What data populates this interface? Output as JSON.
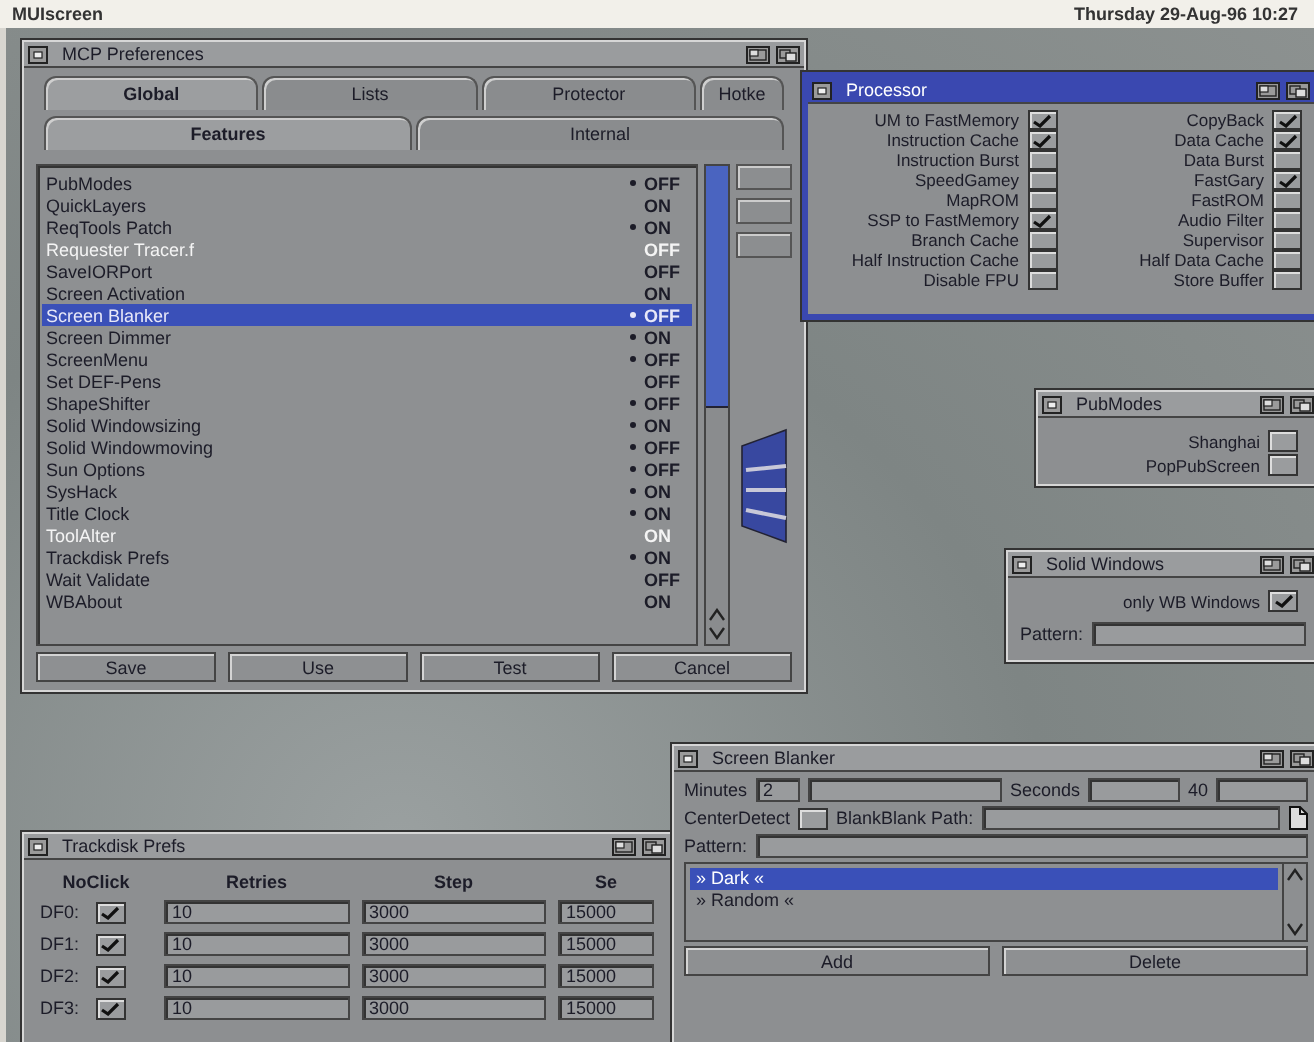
{
  "screen_title": "MUIscreen",
  "clock": "Thursday 29-Aug-96 10:27",
  "mcp_window": {
    "title": "MCP Preferences",
    "tabs": [
      {
        "label": "Global",
        "selected": true
      },
      {
        "label": "Lists",
        "selected": false
      },
      {
        "label": "Protector",
        "selected": false
      },
      {
        "label": "Hotke",
        "selected": false
      }
    ],
    "subtabs": [
      {
        "label": "Features",
        "selected": true
      },
      {
        "label": "Internal",
        "selected": false
      }
    ],
    "items": [
      {
        "name": "PubModes",
        "marked": true,
        "value": "OFF",
        "disabled": false,
        "selected": false
      },
      {
        "name": "QuickLayers",
        "marked": false,
        "value": "ON",
        "disabled": false,
        "selected": false
      },
      {
        "name": "ReqTools Patch",
        "marked": true,
        "value": "ON",
        "disabled": false,
        "selected": false
      },
      {
        "name": "Requester Tracer.f",
        "marked": false,
        "value": "OFF",
        "disabled": true,
        "selected": false
      },
      {
        "name": "SaveIORPort",
        "marked": false,
        "value": "OFF",
        "disabled": false,
        "selected": false
      },
      {
        "name": "Screen Activation",
        "marked": false,
        "value": "ON",
        "disabled": false,
        "selected": false
      },
      {
        "name": "Screen Blanker",
        "marked": true,
        "value": "OFF",
        "disabled": false,
        "selected": true
      },
      {
        "name": "Screen Dimmer",
        "marked": true,
        "value": "ON",
        "disabled": false,
        "selected": false
      },
      {
        "name": "ScreenMenu",
        "marked": true,
        "value": "OFF",
        "disabled": false,
        "selected": false
      },
      {
        "name": "Set DEF-Pens",
        "marked": false,
        "value": "OFF",
        "disabled": false,
        "selected": false
      },
      {
        "name": "ShapeShifter",
        "marked": true,
        "value": "OFF",
        "disabled": false,
        "selected": false
      },
      {
        "name": "Solid Windowsizing",
        "marked": true,
        "value": "ON",
        "disabled": false,
        "selected": false
      },
      {
        "name": "Solid Windowmoving",
        "marked": true,
        "value": "OFF",
        "disabled": false,
        "selected": false
      },
      {
        "name": "Sun Options",
        "marked": true,
        "value": "OFF",
        "disabled": false,
        "selected": false
      },
      {
        "name": "SysHack",
        "marked": true,
        "value": "ON",
        "disabled": false,
        "selected": false
      },
      {
        "name": "Title Clock",
        "marked": true,
        "value": "ON",
        "disabled": false,
        "selected": false
      },
      {
        "name": "ToolAlter",
        "marked": false,
        "value": "ON",
        "disabled": true,
        "selected": false
      },
      {
        "name": "Trackdisk Prefs",
        "marked": true,
        "value": "ON",
        "disabled": false,
        "selected": false
      },
      {
        "name": "Wait Validate",
        "marked": false,
        "value": "OFF",
        "disabled": false,
        "selected": false
      },
      {
        "name": "WBAbout",
        "marked": false,
        "value": "ON",
        "disabled": false,
        "selected": false
      }
    ],
    "buttons": [
      "Save",
      "Use",
      "Test",
      "Cancel"
    ]
  },
  "processor_window": {
    "title": "Processor",
    "options": [
      {
        "label": "UM to FastMemory",
        "checked": true
      },
      {
        "label": "CopyBack",
        "checked": true
      },
      {
        "label": "Instruction Cache",
        "checked": true
      },
      {
        "label": "Data Cache",
        "checked": true
      },
      {
        "label": "Instruction Burst",
        "checked": false
      },
      {
        "label": "Data Burst",
        "checked": false
      },
      {
        "label": "SpeedGamey",
        "checked": false
      },
      {
        "label": "FastGary",
        "checked": true
      },
      {
        "label": "MapROM",
        "checked": false
      },
      {
        "label": "FastROM",
        "checked": false
      },
      {
        "label": "SSP to FastMemory",
        "checked": true
      },
      {
        "label": "Audio Filter",
        "checked": false
      },
      {
        "label": "Branch Cache",
        "checked": false
      },
      {
        "label": "Supervisor",
        "checked": false
      },
      {
        "label": "Half Instruction Cache",
        "checked": false
      },
      {
        "label": "Half Data Cache",
        "checked": false
      },
      {
        "label": "Disable FPU",
        "checked": false
      },
      {
        "label": "Store Buffer",
        "checked": false
      }
    ]
  },
  "pubmodes_window": {
    "title": "PubModes",
    "options": [
      {
        "label": "Shanghai",
        "checked": false
      },
      {
        "label": "PopPubScreen",
        "checked": false
      }
    ]
  },
  "solid_windows_window": {
    "title": "Solid Windows",
    "options": [
      {
        "label": "only WB Windows",
        "checked": true
      }
    ],
    "pattern_label": "Pattern:"
  },
  "trackdisk_window": {
    "title": "Trackdisk Prefs",
    "columns": [
      "NoClick",
      "Retries",
      "Step",
      "Se"
    ],
    "rows": [
      {
        "drive": "DF0:",
        "noclick": true,
        "retries": "10",
        "step": "3000",
        "settle": "15000"
      },
      {
        "drive": "DF1:",
        "noclick": true,
        "retries": "10",
        "step": "3000",
        "settle": "15000"
      },
      {
        "drive": "DF2:",
        "noclick": true,
        "retries": "10",
        "step": "3000",
        "settle": "15000"
      },
      {
        "drive": "DF3:",
        "noclick": true,
        "retries": "10",
        "step": "3000",
        "settle": "15000"
      }
    ]
  },
  "blanker_window": {
    "title": "Screen Blanker",
    "minutes_label": "Minutes",
    "minutes": "2",
    "seconds_label": "Seconds",
    "seconds": "40",
    "center_label": "CenterDetect",
    "center_checked": false,
    "path_label": "BlankBlank Path:",
    "pattern_label": "Pattern:",
    "blankers": [
      {
        "label": "» Dark «",
        "selected": true
      },
      {
        "label": "» Random «",
        "selected": false
      }
    ],
    "buttons": [
      "Add",
      "Delete"
    ]
  }
}
